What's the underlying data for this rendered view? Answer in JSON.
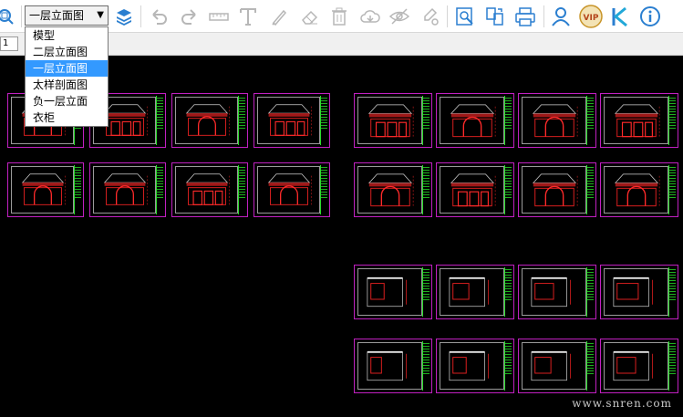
{
  "toolbar": {
    "layout_select": {
      "value": "一层立面图"
    },
    "icons": [
      "zoom-extents-icon",
      "layers-icon",
      "undo-icon",
      "redo-icon",
      "measure-icon",
      "text-icon",
      "pen-icon",
      "eraser-icon",
      "delete-icon",
      "cloud-icon",
      "hide-icon",
      "settings-icon",
      "search-icon",
      "compare-icon",
      "print-icon",
      "user-icon",
      "vip-icon",
      "k-logo-icon",
      "info-icon"
    ],
    "vip_label": "VIP",
    "accent_color": "#2b7fd0"
  },
  "dropdown": {
    "options": [
      "模型",
      "二层立面图",
      "一层立面图",
      "太样剖面图",
      "负一层立面",
      "衣柜"
    ],
    "selected_index": 2
  },
  "subbar": {
    "tab_marker": "1"
  },
  "canvas": {
    "background": "#000000",
    "sheet_border_color": "#c020c0",
    "sheet_groups": [
      {
        "name": "group-left-top",
        "count": 4
      },
      {
        "name": "group-left-bottom",
        "count": 4
      },
      {
        "name": "group-right-top",
        "count": 4
      },
      {
        "name": "group-right-second",
        "count": 4
      },
      {
        "name": "group-right-third",
        "count": 4
      },
      {
        "name": "group-right-fourth",
        "count": 4
      }
    ]
  },
  "watermark": "www.snren.com"
}
